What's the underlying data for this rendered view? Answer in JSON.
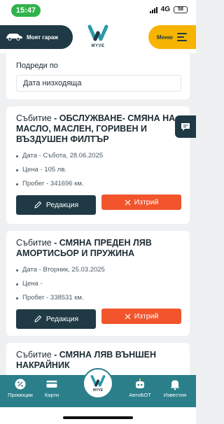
{
  "status": {
    "time": "15:47",
    "network": "4G",
    "battery": "58"
  },
  "header": {
    "garage_label": "Моят гараж",
    "logo_text": "MYVE",
    "menu_label": "Меню"
  },
  "sort": {
    "label": "Подреди по",
    "value": "Дата низходяща"
  },
  "events": [
    {
      "prefix": "Събитие",
      "name": " - ОБСЛУЖВАНЕ- СМЯНА НА МАСЛО, МАСЛЕН, ГОРИВЕН И ВЪЗДУШЕН ФИЛТЪР",
      "date": "Дата - Събота, 28.06.2025",
      "price": "Цена - 105 лв.",
      "mileage": "Пробег - 341696 км.",
      "edit_label": "Редакция",
      "delete_label": "Изтрий"
    },
    {
      "prefix": "Събитие",
      "name": " - СМЯНА ПРЕДЕН ЛЯВ АМОРТИСЬОР И ПРУЖИНА",
      "date": "Дата - Вторник, 25.03.2025",
      "price": "Цена -",
      "mileage": "Пробег - 338531 км.",
      "edit_label": "Редакция",
      "delete_label": "Изтрий"
    },
    {
      "prefix": "Събитие",
      "name": " - СМЯНА ЛЯВ ВЪНШЕН НАКРАЙНИК"
    }
  ],
  "nav": {
    "promotions": "Промоции",
    "cards": "Карти",
    "center_logo": "MYVE",
    "autobot": "АвтоБОТ",
    "notifications": "Известия"
  },
  "colors": {
    "primary": "#1f3a45",
    "accent": "#f6b400",
    "danger": "#f2552c",
    "nav": "#2a7f8a",
    "status_green": "#2fb34a"
  }
}
